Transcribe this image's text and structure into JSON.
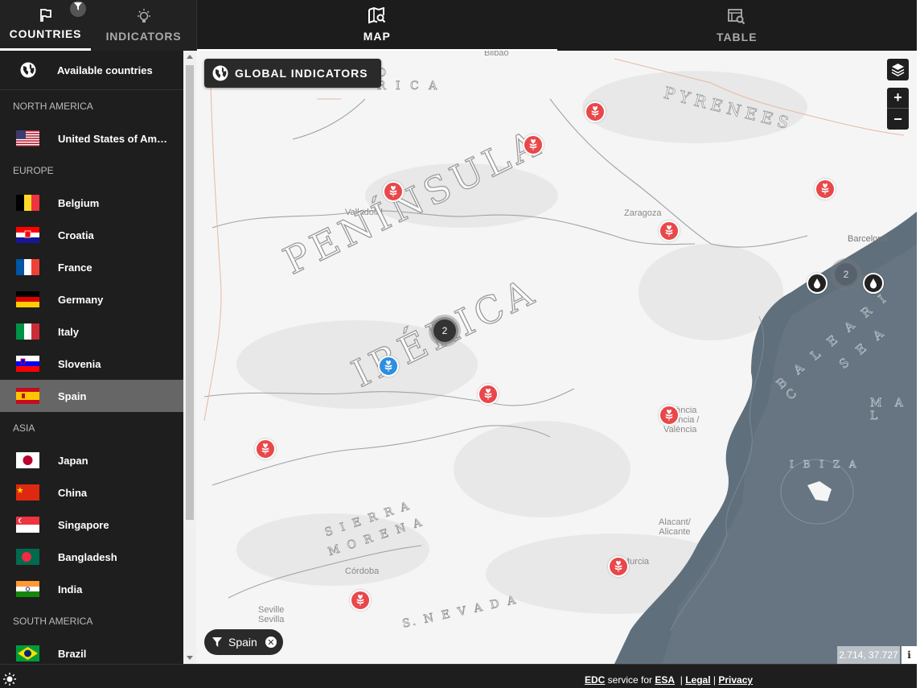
{
  "left_tabs": {
    "countries": "COUNTRIES",
    "indicators": "INDICATORS"
  },
  "main_tabs": {
    "map": "MAP",
    "table": "TABLE"
  },
  "sidebar": {
    "available": "Available countries",
    "regions": [
      {
        "name": "NORTH AMERICA",
        "countries": [
          "United States of America"
        ]
      },
      {
        "name": "EUROPE",
        "countries": [
          "Belgium",
          "Croatia",
          "France",
          "Germany",
          "Italy",
          "Slovenia",
          "Spain"
        ]
      },
      {
        "name": "ASIA",
        "countries": [
          "Japan",
          "China",
          "Singapore",
          "Bangladesh",
          "India"
        ]
      },
      {
        "name": "SOUTH AMERICA",
        "countries": [
          "Brazil"
        ]
      }
    ],
    "selected": "Spain"
  },
  "map": {
    "global_indicators": "GLOBAL INDICATORS",
    "filter_chip": "Spain",
    "coords": "2.714, 37.727",
    "info": "i",
    "zoom_in": "+",
    "zoom_out": "−",
    "cluster_center": "2",
    "cluster_east": "2",
    "labels": {
      "bilbao": "Bilbao",
      "rica_top": "D\nR I C A",
      "pyrenees": "PYRENEES",
      "valladolid": "Valladolid",
      "zaragoza": "Zaragoza",
      "barcelona": "Barcelona",
      "peninsula": "PENÍNSULA",
      "iberica": "IBÉRICA",
      "valencia": "València\nValència /\nValència",
      "balearic": "B A L E A R I C",
      "sea": "S E A",
      "mal": "M A L",
      "ibiza": "I B I Z A",
      "sierra": "S I E R R A",
      "morena": "M O R E N A",
      "alacant": "Alacant/\nAlicante",
      "murcia": "Murcia",
      "cordoba": "Córdoba",
      "seville": "Seville\nSevilla",
      "nevada": "S.  N E V A D A"
    }
  },
  "footer": {
    "edc": "EDC",
    "service_for": " service for ",
    "esa": "ESA",
    "legal": "Legal",
    "privacy": "Privacy"
  },
  "colors": {
    "marker_red": "#e8484a",
    "marker_blue": "#2d8fe0",
    "sea": "#5f6f7b",
    "dark_panel": "#1e1e1e"
  }
}
